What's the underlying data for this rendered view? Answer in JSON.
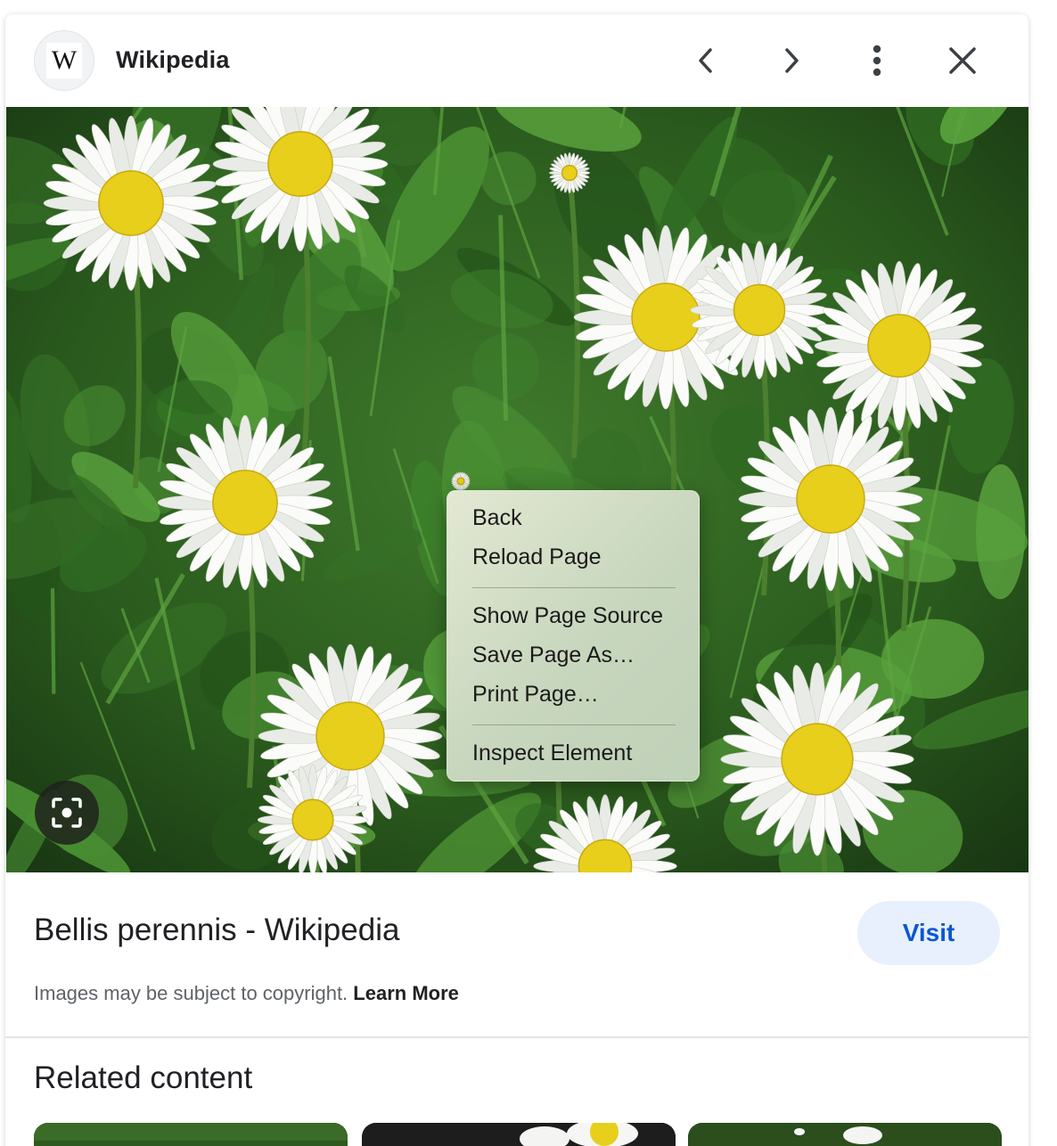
{
  "header": {
    "site_name": "Wikipedia",
    "logo_letter": "W",
    "icons": [
      "back-arrow-icon",
      "forward-arrow-icon",
      "more-vert-icon",
      "close-icon"
    ]
  },
  "image": {
    "subject": "daisy-flowers-photo",
    "lens_icon": "google-lens-icon"
  },
  "context_menu": {
    "items": [
      {
        "label": "Back"
      },
      {
        "label": "Reload Page"
      },
      {
        "label": "Show Page Source"
      },
      {
        "label": "Save Page As…"
      },
      {
        "label": "Print Page…"
      },
      {
        "label": "Inspect Element"
      }
    ]
  },
  "result": {
    "title": "Bellis perennis - Wikipedia",
    "visit_label": "Visit",
    "copyright_text": "Images may be subject to copyright.",
    "learn_more_label": "Learn More"
  },
  "related": {
    "heading": "Related content",
    "thumbnails": [
      "related-thumb-1",
      "related-thumb-2",
      "related-thumb-3"
    ]
  },
  "colors": {
    "accent": "#0b57d0",
    "visit_bg": "#e8f0fe",
    "leaf_dark": "#1f3d16",
    "daisy_center": "#e7cf1c"
  }
}
